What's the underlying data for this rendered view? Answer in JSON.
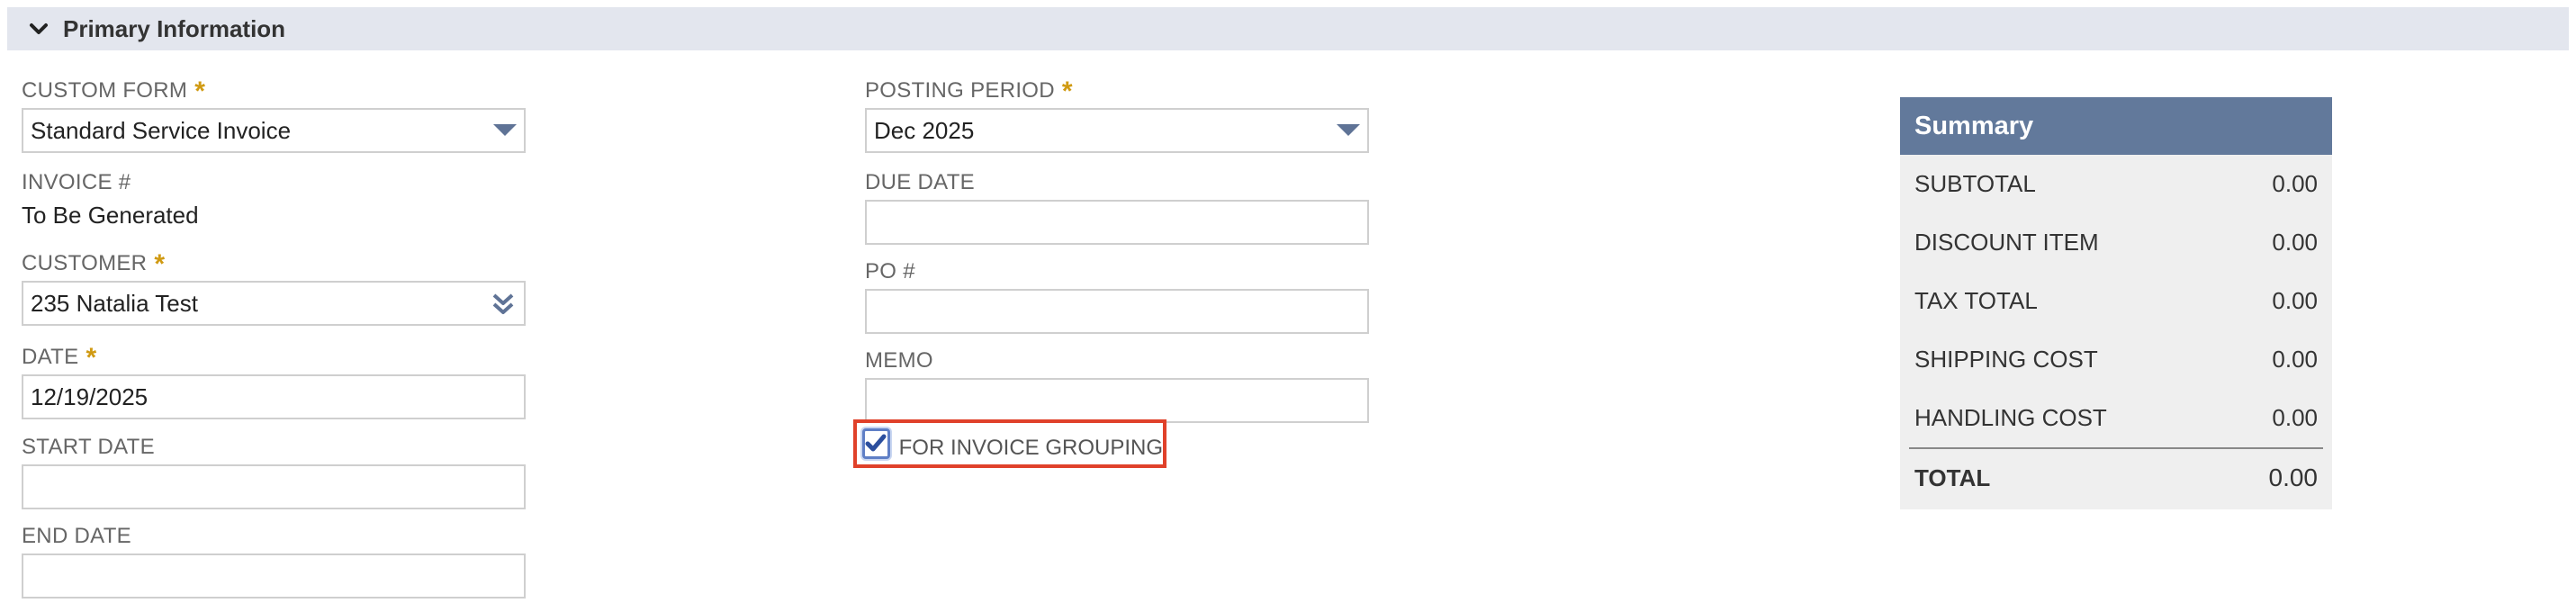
{
  "section": {
    "title": "Primary Information"
  },
  "left": {
    "custom_form": {
      "label": "CUSTOM FORM",
      "required": "*",
      "value": "Standard Service Invoice"
    },
    "invoice_number": {
      "label": "INVOICE #",
      "value": "To Be Generated"
    },
    "customer": {
      "label": "CUSTOMER",
      "required": "*",
      "value": "235 Natalia Test"
    },
    "date": {
      "label": "DATE",
      "required": "*",
      "value": "12/19/2025"
    },
    "start_date": {
      "label": "START DATE",
      "value": ""
    },
    "end_date": {
      "label": "END DATE",
      "value": ""
    }
  },
  "middle": {
    "posting_period": {
      "label": "POSTING PERIOD",
      "required": "*",
      "value": "Dec 2025"
    },
    "due_date": {
      "label": "DUE DATE",
      "value": ""
    },
    "po_number": {
      "label": "PO #",
      "value": ""
    },
    "memo": {
      "label": "MEMO",
      "value": ""
    },
    "invoice_grouping": {
      "label": "FOR INVOICE GROUPING",
      "checked": true
    }
  },
  "summary": {
    "title": "Summary",
    "rows": [
      {
        "label": "SUBTOTAL",
        "amount": "0.00"
      },
      {
        "label": "DISCOUNT ITEM",
        "amount": "0.00"
      },
      {
        "label": "TAX TOTAL",
        "amount": "0.00"
      },
      {
        "label": "SHIPPING COST",
        "amount": "0.00"
      },
      {
        "label": "HANDLING COST",
        "amount": "0.00"
      }
    ],
    "total": {
      "label": "TOTAL",
      "amount": "0.00"
    }
  },
  "colors": {
    "header_bg": "#e3e6ee",
    "summary_header": "#62799b",
    "required": "#d09a12",
    "highlight": "#e0412a",
    "checkbox": "#5f7fc6"
  },
  "icons": {
    "section_toggle": "chevron-down-icon",
    "dropdown": "caret-down-icon",
    "customer_select": "double-chevron-down-icon",
    "checkbox": "checkmark-icon"
  }
}
